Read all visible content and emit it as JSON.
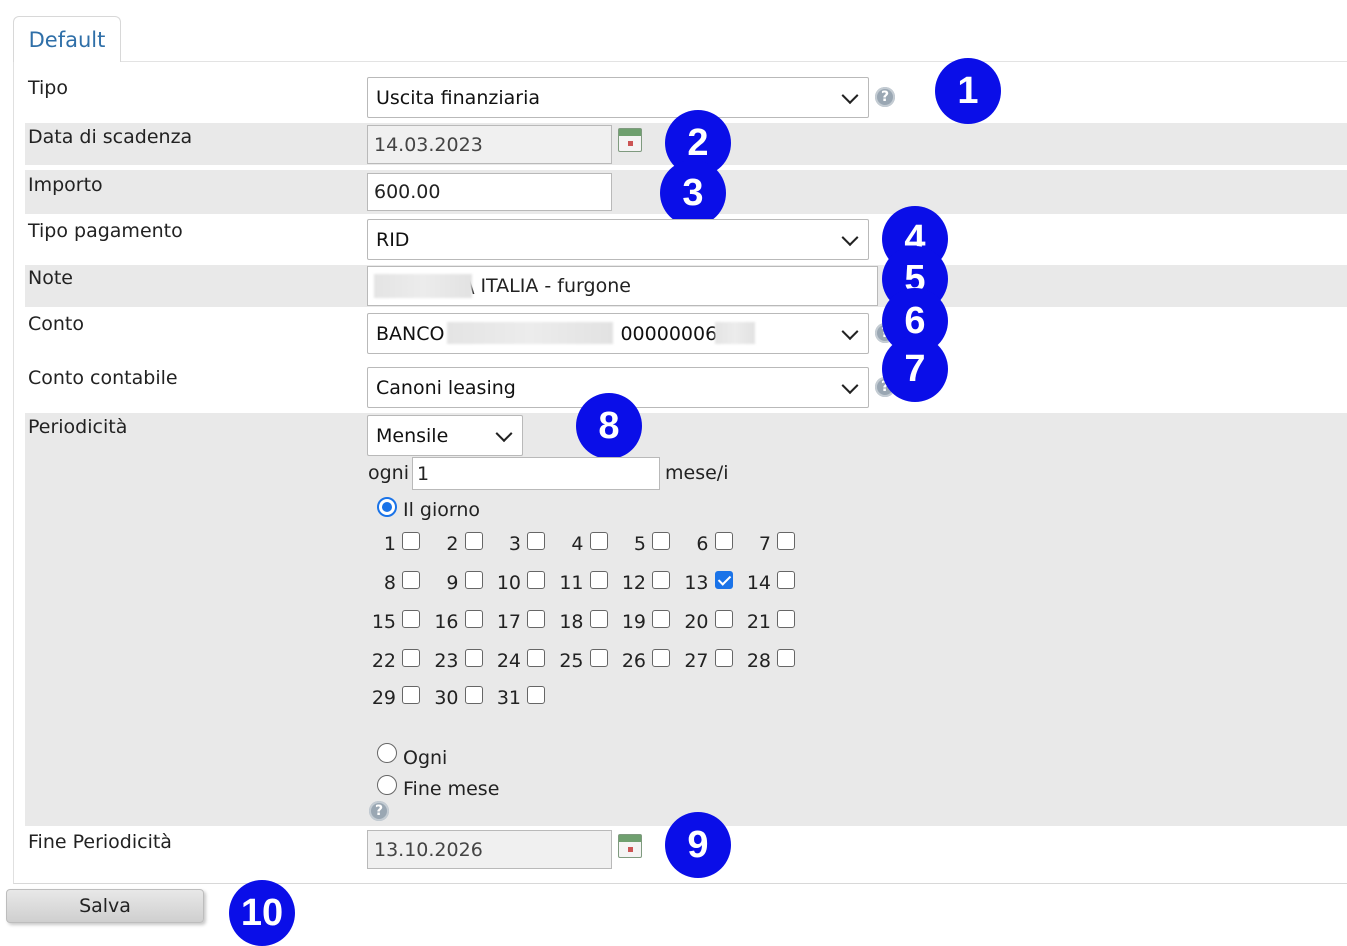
{
  "tab": {
    "label": "Default"
  },
  "form": {
    "tipo": {
      "label": "Tipo",
      "value": "Uscita finanziaria"
    },
    "data_scadenza": {
      "label": "Data di scadenza",
      "value": "14.03.2023"
    },
    "importo": {
      "label": "Importo",
      "value": "600.00"
    },
    "tipo_pagamento": {
      "label": "Tipo pagamento",
      "value": "RID"
    },
    "note": {
      "label": "Note",
      "value": "\\ ITALIA - furgone"
    },
    "conto": {
      "label": "Conto",
      "value_prefix": "BANCO",
      "value_suffix": "00000006"
    },
    "conto_contabile": {
      "label": "Conto contabile",
      "value": "Canoni leasing"
    },
    "periodicita": {
      "label": "Periodicità",
      "value": "Mensile",
      "ogni_label": "ogni",
      "ogni_value": "1",
      "unit_label": "mese/i",
      "option_il_giorno": "Il giorno",
      "option_ogni": "Ogni",
      "option_fine_mese": "Fine mese",
      "days": [
        "1",
        "2",
        "3",
        "4",
        "5",
        "6",
        "7",
        "8",
        "9",
        "10",
        "11",
        "12",
        "13",
        "14",
        "15",
        "16",
        "17",
        "18",
        "19",
        "20",
        "21",
        "22",
        "23",
        "24",
        "25",
        "26",
        "27",
        "28",
        "29",
        "30",
        "31"
      ],
      "checked_day": "13",
      "selected_option": "Il giorno"
    },
    "fine_periodicita": {
      "label": "Fine Periodicità",
      "value": "13.10.2026"
    }
  },
  "buttons": {
    "save_label": "Salva"
  },
  "help_icon_text": "?",
  "annotations": [
    "1",
    "2",
    "3",
    "4",
    "5",
    "6",
    "7",
    "8",
    "9",
    "10"
  ],
  "colors": {
    "badge": "#0a0ee8",
    "tab_text": "#2f6fa8",
    "row_gray": "#e9e9e9",
    "checkbox_checked": "#1a73e8"
  }
}
